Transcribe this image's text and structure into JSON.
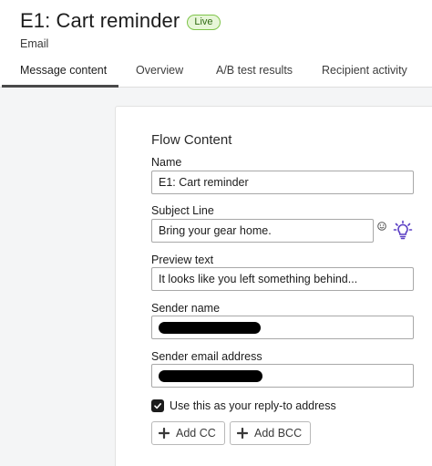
{
  "header": {
    "title": "E1: Cart reminder",
    "status_badge": "Live",
    "subtitle": "Email"
  },
  "tabs": [
    {
      "label": "Message content",
      "active": true
    },
    {
      "label": "Overview",
      "active": false
    },
    {
      "label": "A/B test results",
      "active": false
    },
    {
      "label": "Recipient activity",
      "active": false
    }
  ],
  "form": {
    "section_title": "Flow Content",
    "name_label": "Name",
    "name_value": "E1: Cart reminder",
    "subject_label": "Subject Line",
    "subject_value": "Bring your gear home.",
    "preview_label": "Preview text",
    "preview_value": "It looks like you left something behind...",
    "sender_name_label": "Sender name",
    "sender_email_label": "Sender email address",
    "reply_to_label": "Use this as your reply-to address",
    "reply_to_checked": true,
    "add_cc_label": "Add CC",
    "add_bcc_label": "Add BCC"
  },
  "icons": {
    "subject_emoji": "smiley-icon",
    "subject_ideas": "lightbulb-icon",
    "checkbox": "checkmark-icon",
    "add": "plus-icon"
  },
  "colors": {
    "live_badge_border": "#7ec44a",
    "live_badge_bg": "#e7f6d8",
    "lightbulb": "#5b3fc4",
    "checkbox": "#1c1c1c"
  }
}
